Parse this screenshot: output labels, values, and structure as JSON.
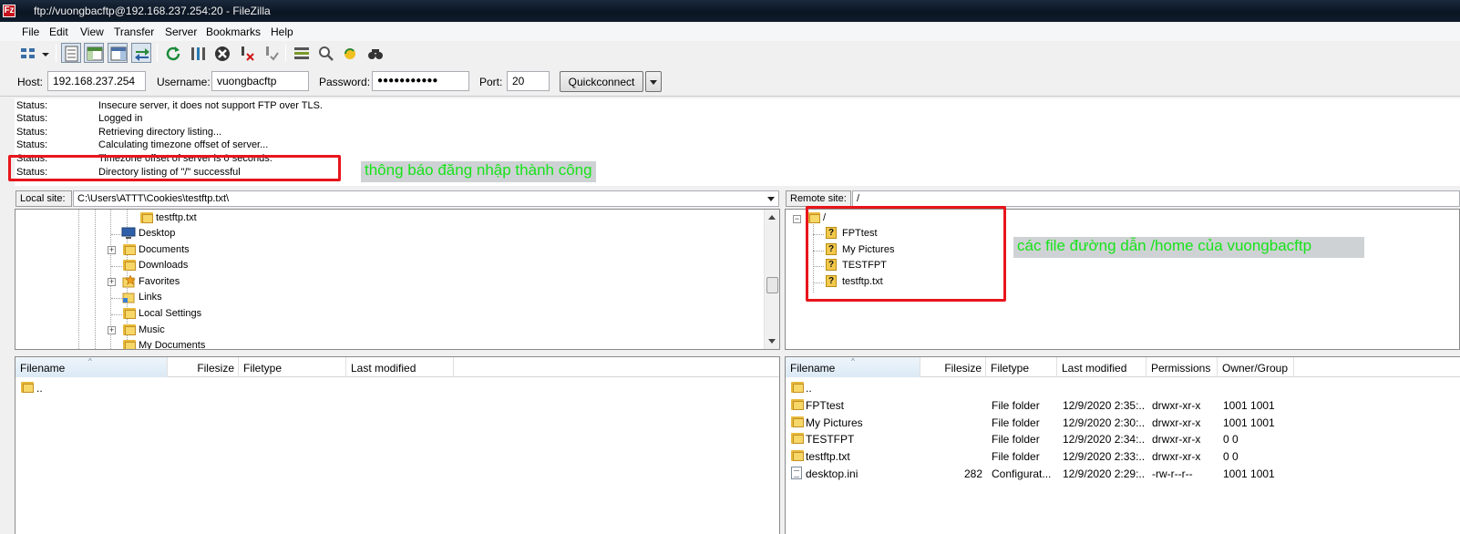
{
  "window": {
    "title": "ftp://vuongbacftp@192.168.237.254:20 - FileZilla",
    "app_icon": "Fz"
  },
  "menu": [
    "File",
    "Edit",
    "View",
    "Transfer",
    "Server",
    "Bookmarks",
    "Help"
  ],
  "toolbar": {
    "icons": [
      "site-manager-icon",
      "site-manager-dropdown-icon",
      "toggle-message-log-icon",
      "toggle-local-tree-icon",
      "toggle-remote-tree-icon",
      "toggle-transfer-queue-icon",
      "refresh-icon",
      "process-queue-icon",
      "cancel-icon",
      "disconnect-icon",
      "reconnect-icon",
      "directory-comparison-icon",
      "filter-icon",
      "sync-browsing-icon",
      "search-icon"
    ]
  },
  "quickconnect": {
    "host_label": "Host:",
    "host_value": "192.168.237.254",
    "username_label": "Username:",
    "username_value": "vuongbacftp",
    "password_label": "Password:",
    "password_value": "●●●●●●●●●●●",
    "port_label": "Port:",
    "port_value": "20",
    "button_label": "Quickconnect"
  },
  "log": [
    {
      "key": "Status:",
      "text": "Insecure server, it does not support FTP over TLS."
    },
    {
      "key": "Status:",
      "text": "Logged in"
    },
    {
      "key": "Status:",
      "text": "Retrieving directory listing..."
    },
    {
      "key": "Status:",
      "text": "Calculating timezone offset of server..."
    },
    {
      "key": "Status:",
      "text": "Timezone offset of server is 0 seconds."
    },
    {
      "key": "Status:",
      "text": "Directory listing of \"/\" successful"
    }
  ],
  "annotations": {
    "login_success": "thông báo đăng nhập thành công",
    "remote_files": "các file đường dẫn /home của vuongbacftp",
    "color": "#18e21c",
    "box_color": "#e8151c"
  },
  "local": {
    "site_label": "Local site:",
    "path": "C:\\Users\\ATTT\\Cookies\\testftp.txt\\",
    "tree": [
      {
        "label": "testftp.txt",
        "icon": "folder-icon"
      },
      {
        "label": "Desktop",
        "icon": "desktop-icon"
      },
      {
        "label": "Documents",
        "icon": "folder-icon",
        "expand": true
      },
      {
        "label": "Downloads",
        "icon": "folder-icon"
      },
      {
        "label": "Favorites",
        "icon": "favorites-folder-icon",
        "expand": true
      },
      {
        "label": "Links",
        "icon": "links-folder-icon"
      },
      {
        "label": "Local Settings",
        "icon": "folder-icon"
      },
      {
        "label": "Music",
        "icon": "folder-icon",
        "expand": true
      },
      {
        "label": "My Documents",
        "icon": "folder-icon"
      }
    ],
    "columns": [
      "Filename",
      "Filesize",
      "Filetype",
      "Last modified"
    ],
    "files": [
      {
        "name": "..",
        "icon": "folder-icon"
      }
    ]
  },
  "remote": {
    "site_label": "Remote site:",
    "path": "/",
    "tree_root": "/",
    "tree": [
      "FPTtest",
      "My Pictures",
      "TESTFPT",
      "testftp.txt"
    ],
    "columns": [
      "Filename",
      "Filesize",
      "Filetype",
      "Last modified",
      "Permissions",
      "Owner/Group"
    ],
    "files": [
      {
        "name": "..",
        "size": "",
        "type": "",
        "modified": "",
        "perms": "",
        "owner": "",
        "icon": "folder-icon"
      },
      {
        "name": "FPTtest",
        "size": "",
        "type": "File folder",
        "modified": "12/9/2020 2:35:...",
        "perms": "drwxr-xr-x",
        "owner": "1001 1001",
        "icon": "folder-icon"
      },
      {
        "name": "My Pictures",
        "size": "",
        "type": "File folder",
        "modified": "12/9/2020 2:30:...",
        "perms": "drwxr-xr-x",
        "owner": "1001 1001",
        "icon": "folder-icon"
      },
      {
        "name": "TESTFPT",
        "size": "",
        "type": "File folder",
        "modified": "12/9/2020 2:34:...",
        "perms": "drwxr-xr-x",
        "owner": "0 0",
        "icon": "folder-icon"
      },
      {
        "name": "testftp.txt",
        "size": "",
        "type": "File folder",
        "modified": "12/9/2020 2:33:...",
        "perms": "drwxr-xr-x",
        "owner": "0 0",
        "icon": "folder-icon"
      },
      {
        "name": "desktop.ini",
        "size": "282",
        "type": "Configurat...",
        "modified": "12/9/2020 2:29:...",
        "perms": "-rw-r--r--",
        "owner": "1001 1001",
        "icon": "file-icon"
      }
    ]
  }
}
